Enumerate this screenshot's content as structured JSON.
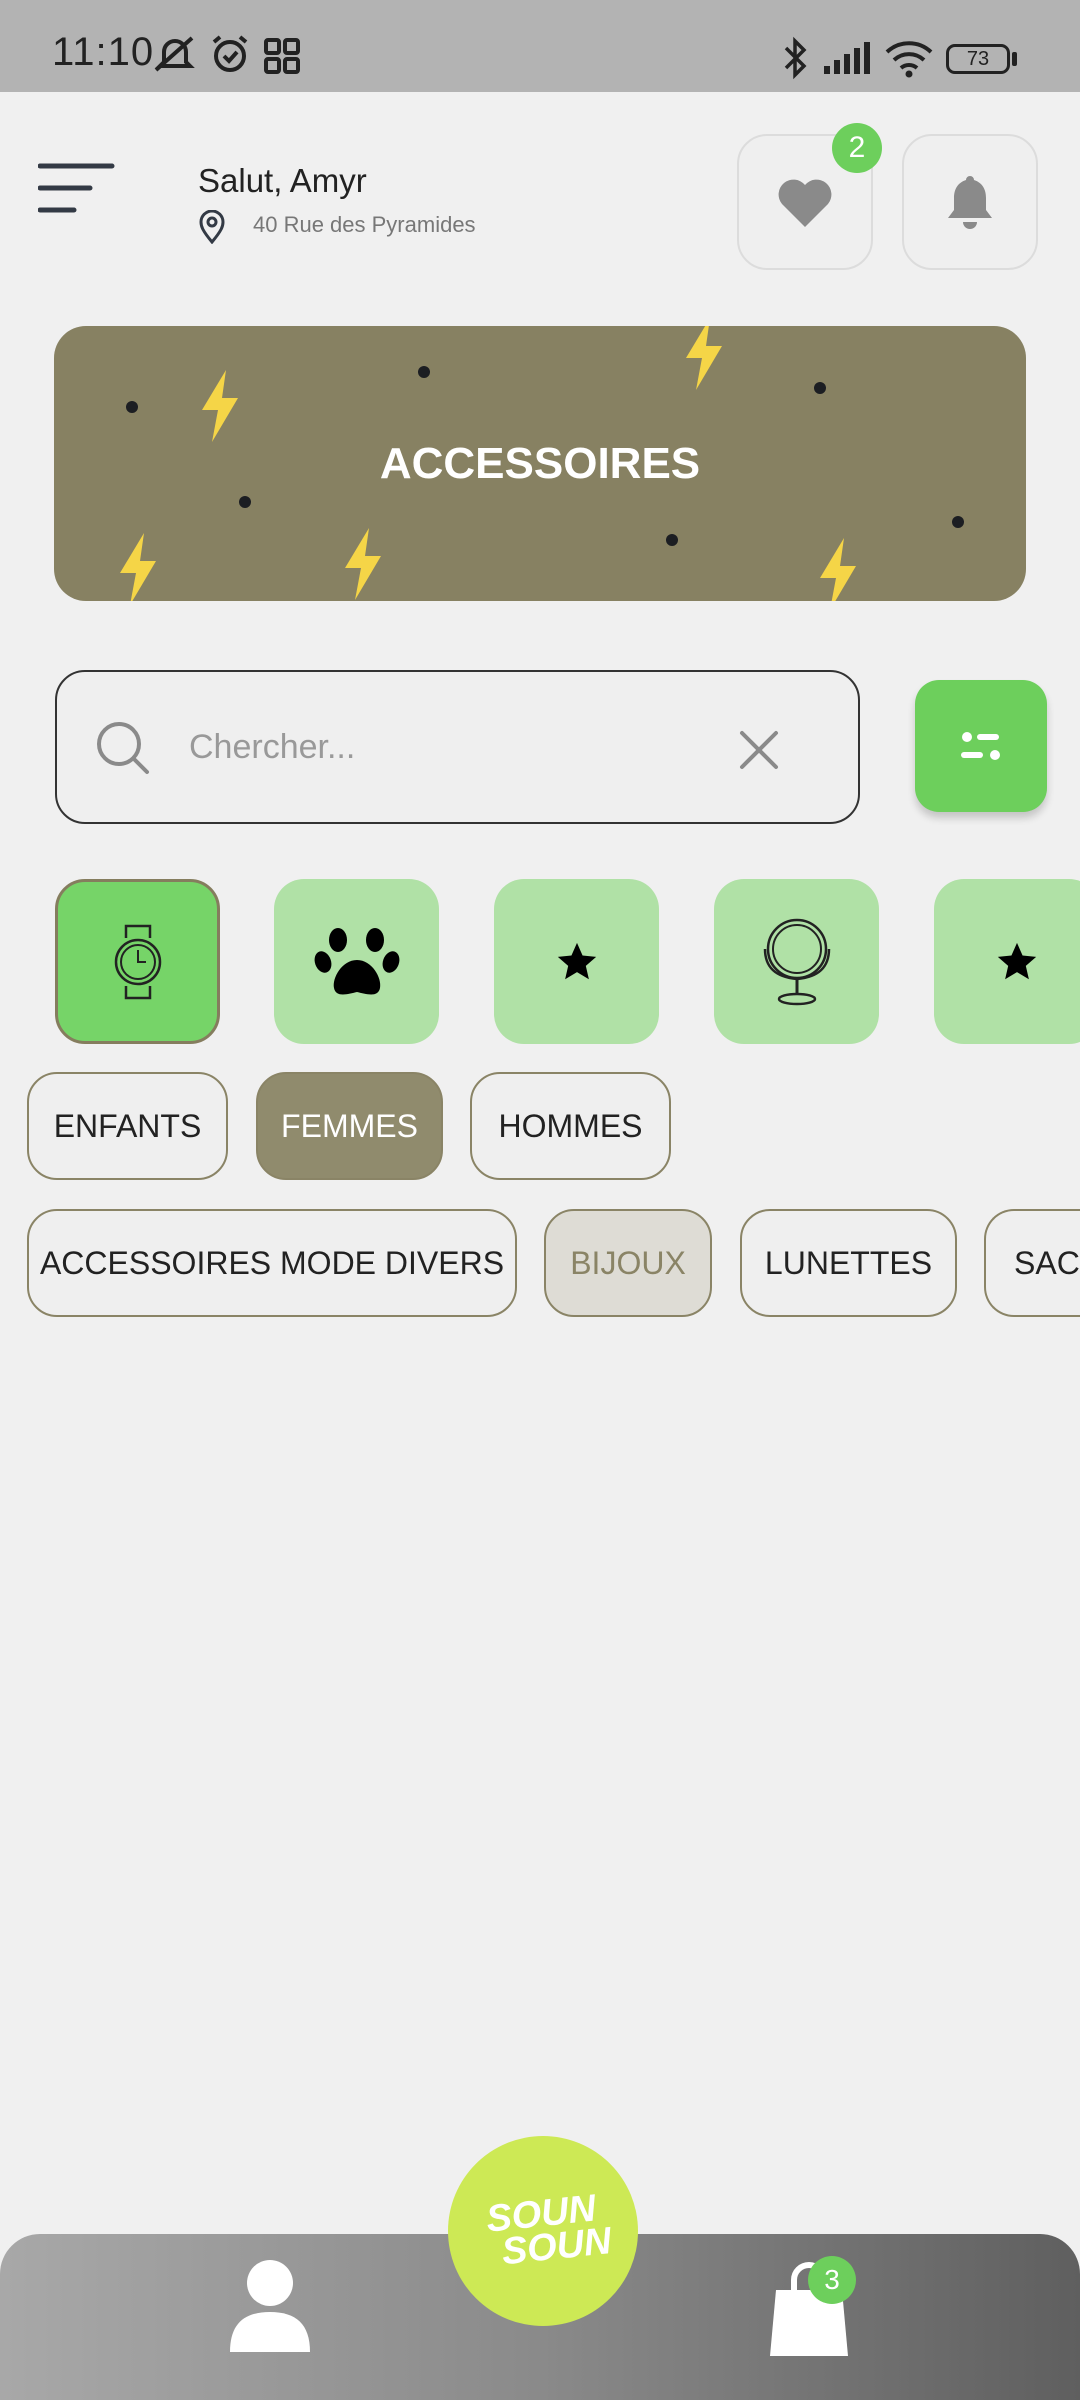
{
  "status_bar": {
    "time": "11:10",
    "battery": "73"
  },
  "header": {
    "greeting": "Salut, Amyr",
    "address": "40 Rue des Pyramides",
    "favorites_count": "2"
  },
  "banner": {
    "title": "ACCESSOIRES"
  },
  "search": {
    "placeholder": "Chercher..."
  },
  "category_icons": [
    "watch-icon",
    "paw-icon",
    "star-icon",
    "mirror-icon",
    "star-icon"
  ],
  "gender_chips": [
    {
      "label": "ENFANTS",
      "selected": false
    },
    {
      "label": "FEMMES",
      "selected": true
    },
    {
      "label": "HOMMES",
      "selected": false
    }
  ],
  "type_chips": [
    {
      "label": "ACCESSOIRES MODE DIVERS"
    },
    {
      "label": "BIJOUX"
    },
    {
      "label": "LUNETTES"
    },
    {
      "label": "SACS"
    }
  ],
  "bottom_nav": {
    "logo_line1": "SOUN",
    "logo_line2": "SOUN",
    "cart_count": "3"
  },
  "colors": {
    "accent_green": "#6dcf5c",
    "olive": "#878162",
    "logo_lime": "#cde955",
    "bolt_yellow": "#f5d547"
  }
}
